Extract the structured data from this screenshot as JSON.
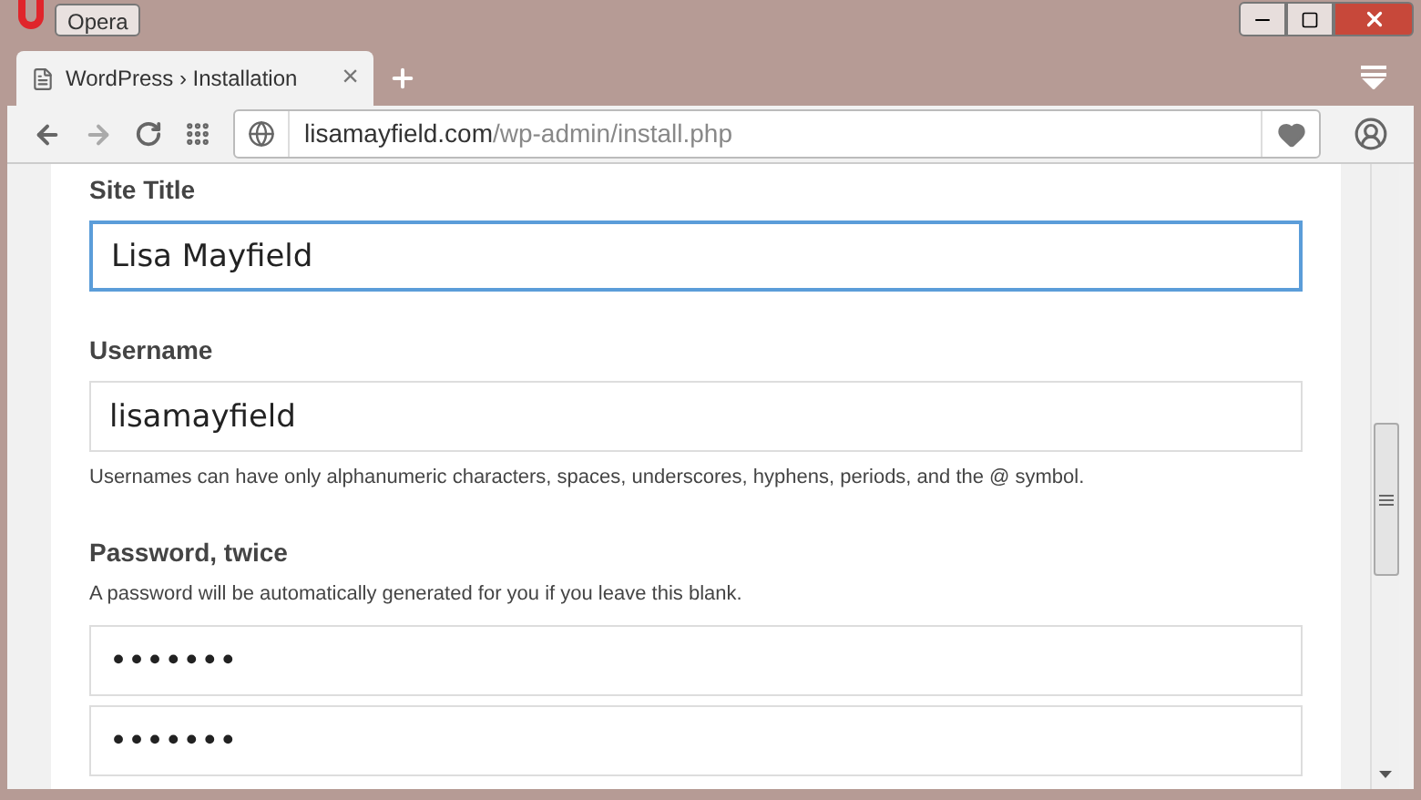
{
  "window": {
    "app_button": "Opera"
  },
  "tabs": [
    {
      "title": "WordPress › Installation",
      "close": "×",
      "selected": true
    }
  ],
  "address_bar": {
    "domain": "lisamayfield.com",
    "path": "/wp-admin/install.php"
  },
  "form": [
    {
      "kind": "field",
      "label": "Site Title",
      "value": "Lisa Mayfield",
      "focused": true
    },
    {
      "kind": "field",
      "label": "Username",
      "value": "lisamayfield",
      "focused": false,
      "hint": "Usernames can have only alphanumeric characters, spaces, underscores, hyphens, periods, and the @ symbol."
    },
    {
      "kind": "password",
      "label": "Password, twice",
      "hint": "A password will be automatically generated for you if you leave this blank.",
      "values": [
        "•••••••",
        "•••••••"
      ]
    }
  ]
}
